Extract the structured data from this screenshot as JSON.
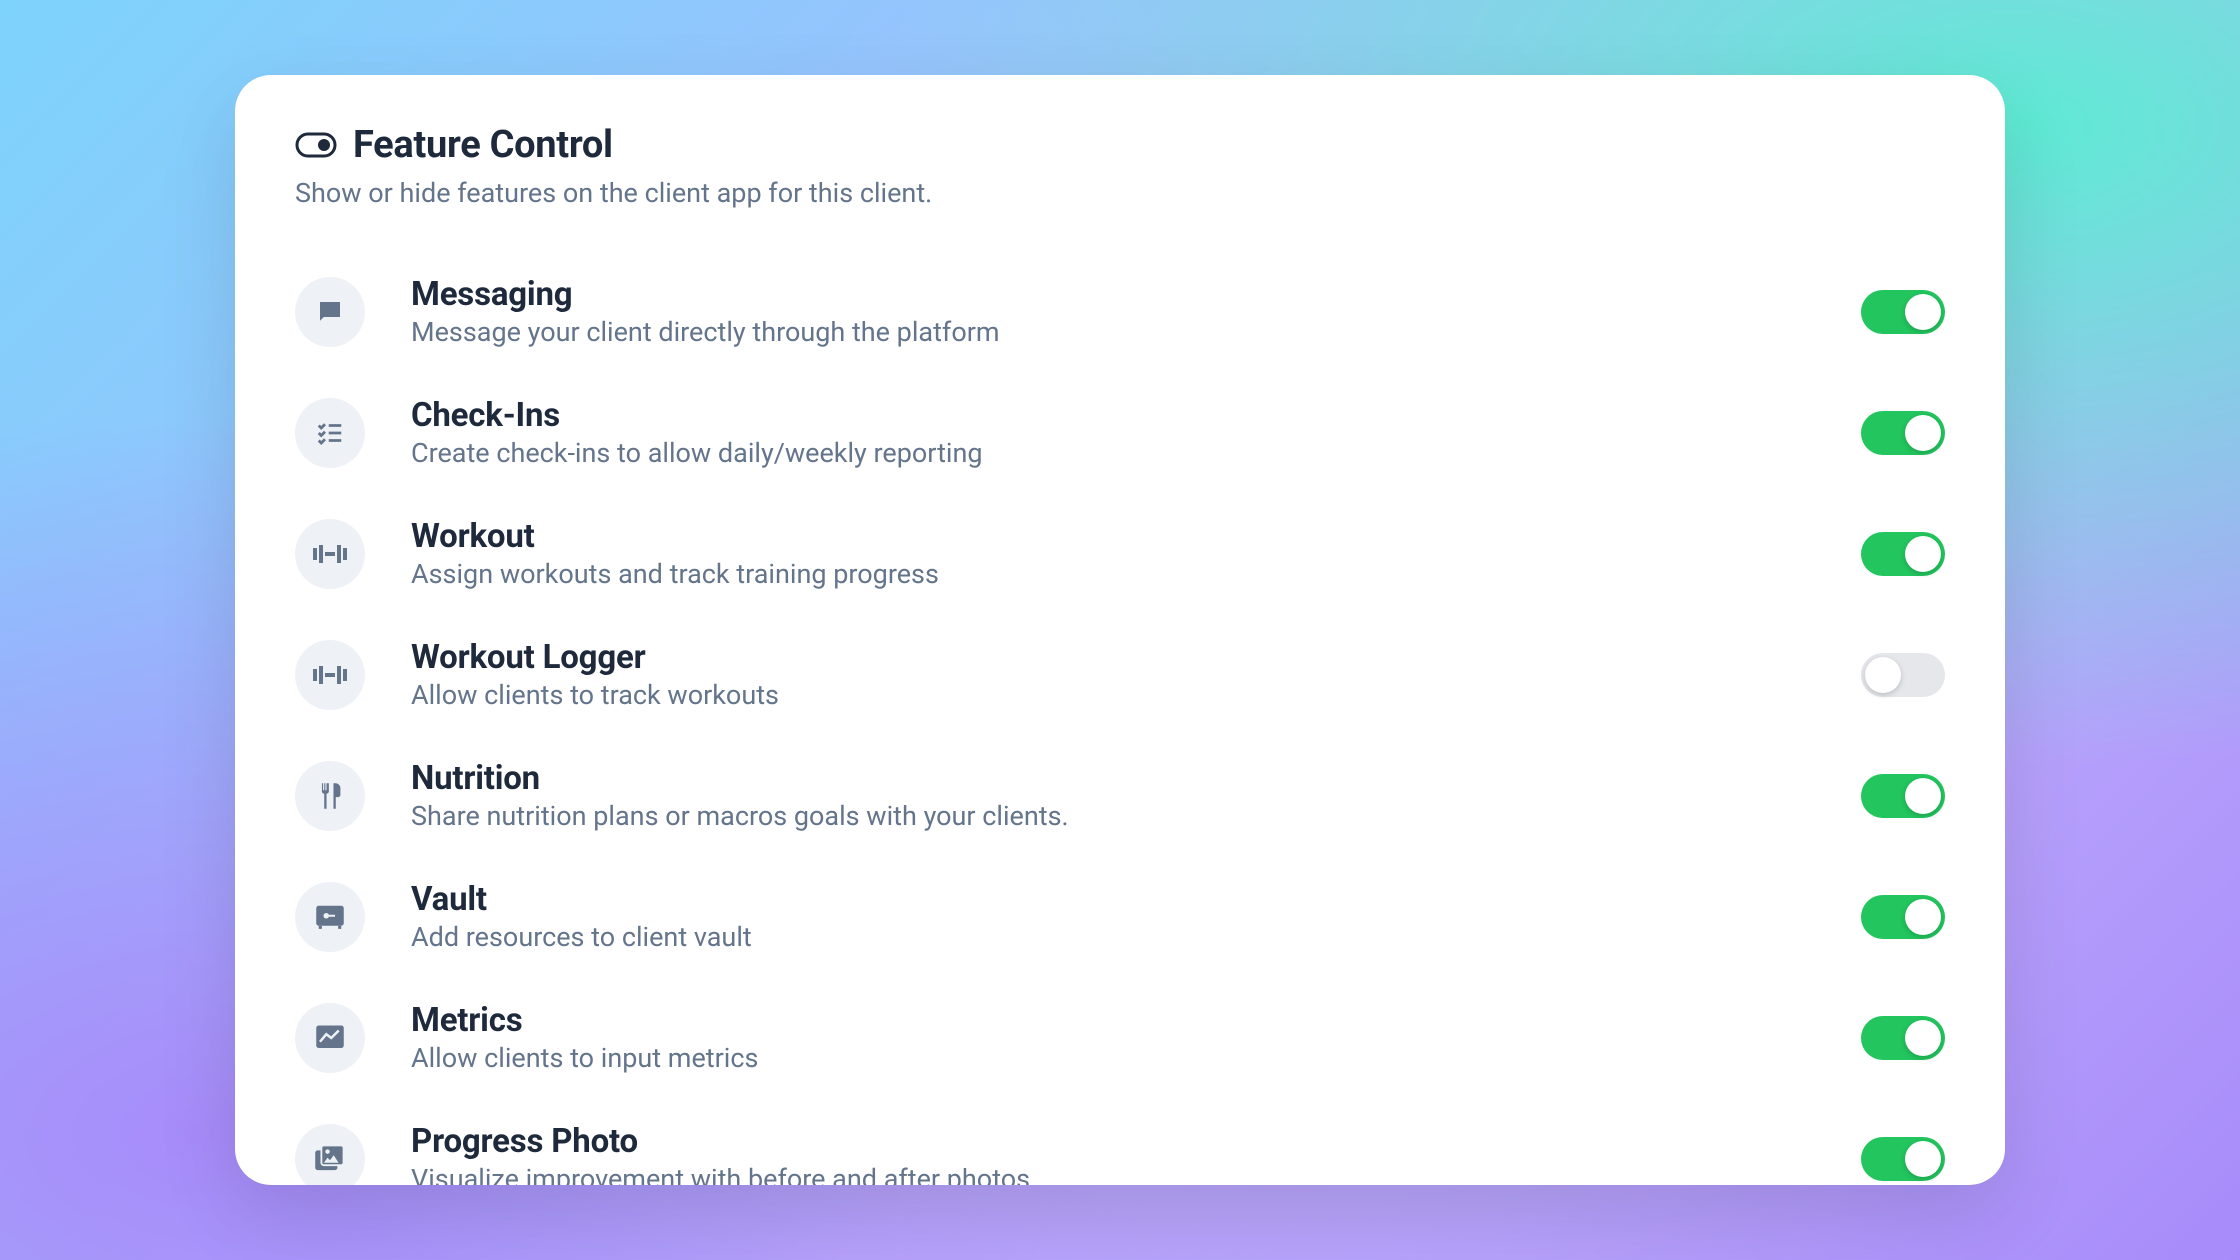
{
  "header": {
    "title": "Feature Control",
    "subtitle": "Show or hide features on the client app for this client."
  },
  "colors": {
    "toggle_on": "#22c55e",
    "toggle_off": "#e5e7eb",
    "icon_bg": "#eef1f5",
    "text_primary": "#1e293b",
    "text_secondary": "#64748b"
  },
  "features": [
    {
      "icon": "messaging",
      "title": "Messaging",
      "description": "Message your client directly through the platform",
      "enabled": true
    },
    {
      "icon": "checkins",
      "title": "Check-Ins",
      "description": "Create check-ins to allow daily/weekly reporting",
      "enabled": true
    },
    {
      "icon": "workout",
      "title": "Workout",
      "description": "Assign workouts and track training progress",
      "enabled": true
    },
    {
      "icon": "workout-logger",
      "title": "Workout Logger",
      "description": "Allow clients to track workouts",
      "enabled": false
    },
    {
      "icon": "nutrition",
      "title": "Nutrition",
      "description": "Share nutrition plans or macros goals with your clients.",
      "enabled": true
    },
    {
      "icon": "vault",
      "title": "Vault",
      "description": "Add resources to client vault",
      "enabled": true
    },
    {
      "icon": "metrics",
      "title": "Metrics",
      "description": "Allow clients to input metrics",
      "enabled": true
    },
    {
      "icon": "progress-photo",
      "title": "Progress Photo",
      "description": "Visualize improvement with before and after photos",
      "enabled": true
    }
  ]
}
